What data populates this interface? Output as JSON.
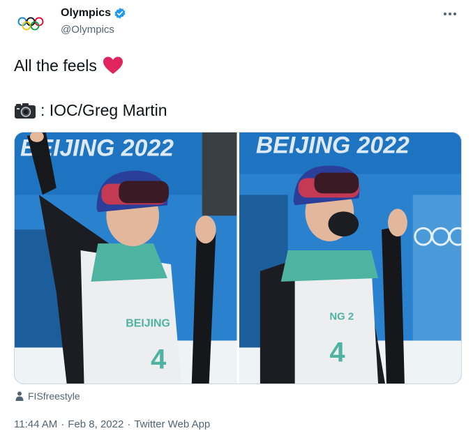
{
  "header": {
    "display_name": "Olympics",
    "handle": "@Olympics",
    "verified": true
  },
  "tweet": {
    "line1_text": "All the feels",
    "line1_icon": "red-heart-icon",
    "line2_icon": "camera-icon",
    "line2_text": ": IOC/Greg Martin"
  },
  "media": {
    "photos": [
      {
        "banner_text": "BEIJING 2022",
        "bib_text": "BEIJING",
        "bib_number": "4"
      },
      {
        "banner_text": "BEIJING 2022",
        "bib_text": "NG 2",
        "bib_number": "4"
      }
    ]
  },
  "footer": {
    "credit": "FISfreestyle",
    "time": "11:44 AM",
    "date": "Feb 8, 2022",
    "app": "Twitter Web App",
    "sep": "·"
  },
  "colors": {
    "verified_blue": "#1d9bf0",
    "heart_red": "#e0245e",
    "secondary_text": "#536471",
    "photo_blue": "#1f78c8"
  }
}
